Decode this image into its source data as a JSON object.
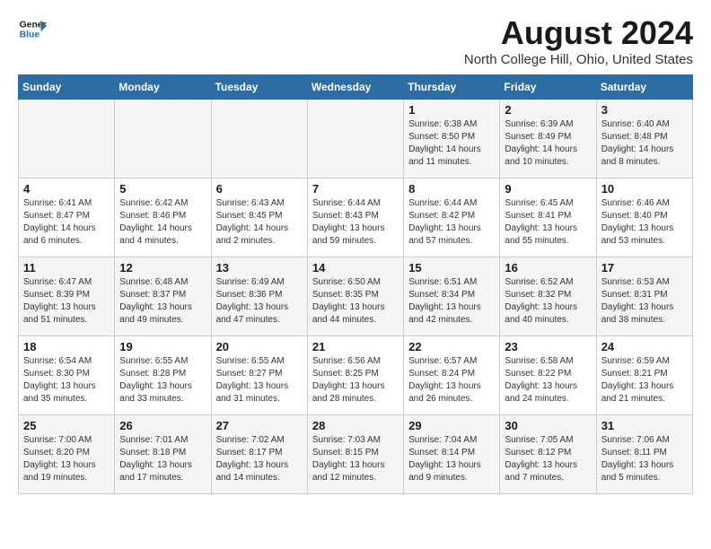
{
  "header": {
    "logo_line1": "General",
    "logo_line2": "Blue",
    "month_title": "August 2024",
    "location": "North College Hill, Ohio, United States"
  },
  "weekdays": [
    "Sunday",
    "Monday",
    "Tuesday",
    "Wednesday",
    "Thursday",
    "Friday",
    "Saturday"
  ],
  "weeks": [
    [
      {
        "day": "",
        "info": ""
      },
      {
        "day": "",
        "info": ""
      },
      {
        "day": "",
        "info": ""
      },
      {
        "day": "",
        "info": ""
      },
      {
        "day": "1",
        "info": "Sunrise: 6:38 AM\nSunset: 8:50 PM\nDaylight: 14 hours and 11 minutes."
      },
      {
        "day": "2",
        "info": "Sunrise: 6:39 AM\nSunset: 8:49 PM\nDaylight: 14 hours and 10 minutes."
      },
      {
        "day": "3",
        "info": "Sunrise: 6:40 AM\nSunset: 8:48 PM\nDaylight: 14 hours and 8 minutes."
      }
    ],
    [
      {
        "day": "4",
        "info": "Sunrise: 6:41 AM\nSunset: 8:47 PM\nDaylight: 14 hours and 6 minutes."
      },
      {
        "day": "5",
        "info": "Sunrise: 6:42 AM\nSunset: 8:46 PM\nDaylight: 14 hours and 4 minutes."
      },
      {
        "day": "6",
        "info": "Sunrise: 6:43 AM\nSunset: 8:45 PM\nDaylight: 14 hours and 2 minutes."
      },
      {
        "day": "7",
        "info": "Sunrise: 6:44 AM\nSunset: 8:43 PM\nDaylight: 13 hours and 59 minutes."
      },
      {
        "day": "8",
        "info": "Sunrise: 6:44 AM\nSunset: 8:42 PM\nDaylight: 13 hours and 57 minutes."
      },
      {
        "day": "9",
        "info": "Sunrise: 6:45 AM\nSunset: 8:41 PM\nDaylight: 13 hours and 55 minutes."
      },
      {
        "day": "10",
        "info": "Sunrise: 6:46 AM\nSunset: 8:40 PM\nDaylight: 13 hours and 53 minutes."
      }
    ],
    [
      {
        "day": "11",
        "info": "Sunrise: 6:47 AM\nSunset: 8:39 PM\nDaylight: 13 hours and 51 minutes."
      },
      {
        "day": "12",
        "info": "Sunrise: 6:48 AM\nSunset: 8:37 PM\nDaylight: 13 hours and 49 minutes."
      },
      {
        "day": "13",
        "info": "Sunrise: 6:49 AM\nSunset: 8:36 PM\nDaylight: 13 hours and 47 minutes."
      },
      {
        "day": "14",
        "info": "Sunrise: 6:50 AM\nSunset: 8:35 PM\nDaylight: 13 hours and 44 minutes."
      },
      {
        "day": "15",
        "info": "Sunrise: 6:51 AM\nSunset: 8:34 PM\nDaylight: 13 hours and 42 minutes."
      },
      {
        "day": "16",
        "info": "Sunrise: 6:52 AM\nSunset: 8:32 PM\nDaylight: 13 hours and 40 minutes."
      },
      {
        "day": "17",
        "info": "Sunrise: 6:53 AM\nSunset: 8:31 PM\nDaylight: 13 hours and 38 minutes."
      }
    ],
    [
      {
        "day": "18",
        "info": "Sunrise: 6:54 AM\nSunset: 8:30 PM\nDaylight: 13 hours and 35 minutes."
      },
      {
        "day": "19",
        "info": "Sunrise: 6:55 AM\nSunset: 8:28 PM\nDaylight: 13 hours and 33 minutes."
      },
      {
        "day": "20",
        "info": "Sunrise: 6:55 AM\nSunset: 8:27 PM\nDaylight: 13 hours and 31 minutes."
      },
      {
        "day": "21",
        "info": "Sunrise: 6:56 AM\nSunset: 8:25 PM\nDaylight: 13 hours and 28 minutes."
      },
      {
        "day": "22",
        "info": "Sunrise: 6:57 AM\nSunset: 8:24 PM\nDaylight: 13 hours and 26 minutes."
      },
      {
        "day": "23",
        "info": "Sunrise: 6:58 AM\nSunset: 8:22 PM\nDaylight: 13 hours and 24 minutes."
      },
      {
        "day": "24",
        "info": "Sunrise: 6:59 AM\nSunset: 8:21 PM\nDaylight: 13 hours and 21 minutes."
      }
    ],
    [
      {
        "day": "25",
        "info": "Sunrise: 7:00 AM\nSunset: 8:20 PM\nDaylight: 13 hours and 19 minutes."
      },
      {
        "day": "26",
        "info": "Sunrise: 7:01 AM\nSunset: 8:18 PM\nDaylight: 13 hours and 17 minutes."
      },
      {
        "day": "27",
        "info": "Sunrise: 7:02 AM\nSunset: 8:17 PM\nDaylight: 13 hours and 14 minutes."
      },
      {
        "day": "28",
        "info": "Sunrise: 7:03 AM\nSunset: 8:15 PM\nDaylight: 13 hours and 12 minutes."
      },
      {
        "day": "29",
        "info": "Sunrise: 7:04 AM\nSunset: 8:14 PM\nDaylight: 13 hours and 9 minutes."
      },
      {
        "day": "30",
        "info": "Sunrise: 7:05 AM\nSunset: 8:12 PM\nDaylight: 13 hours and 7 minutes."
      },
      {
        "day": "31",
        "info": "Sunrise: 7:06 AM\nSunset: 8:11 PM\nDaylight: 13 hours and 5 minutes."
      }
    ]
  ]
}
